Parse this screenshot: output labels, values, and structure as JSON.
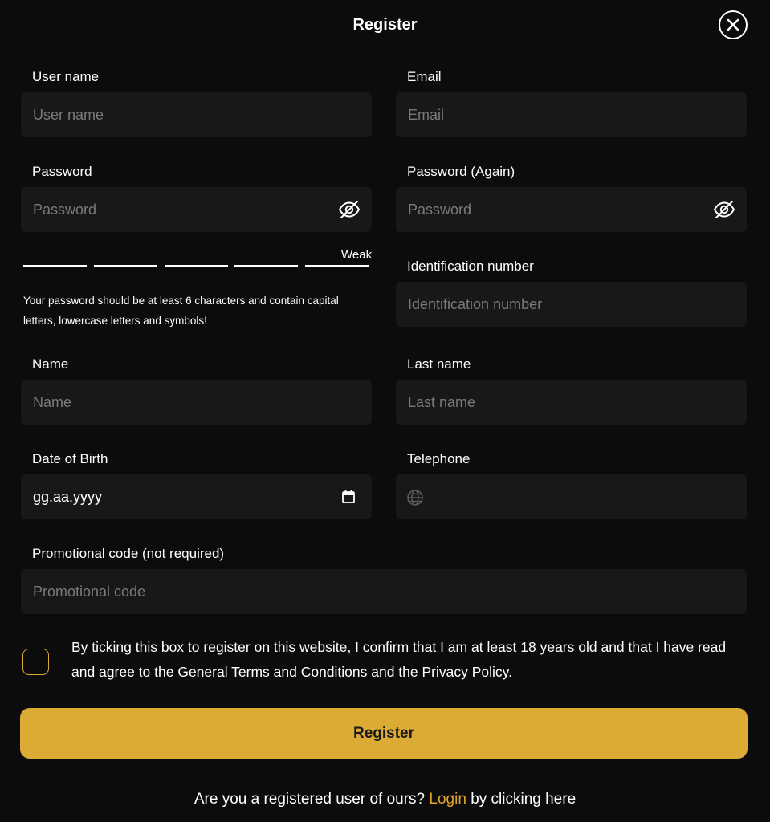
{
  "header": {
    "title": "Register"
  },
  "fields": {
    "username": {
      "label": "User name",
      "placeholder": "User name"
    },
    "email": {
      "label": "Email",
      "placeholder": "Email"
    },
    "password": {
      "label": "Password",
      "placeholder": "Password"
    },
    "password_again": {
      "label": "Password (Again)",
      "placeholder": "Password"
    },
    "identification": {
      "label": "Identification number",
      "placeholder": "Identification number"
    },
    "name": {
      "label": "Name",
      "placeholder": "Name"
    },
    "last_name": {
      "label": "Last name",
      "placeholder": "Last name"
    },
    "dob": {
      "label": "Date of Birth",
      "value": "gg.aa.yyyy"
    },
    "telephone": {
      "label": "Telephone",
      "value": ""
    },
    "promo": {
      "label": "Promotional code (not required)",
      "placeholder": "Promotional code"
    }
  },
  "password_strength": {
    "label": "Weak",
    "segments": 5,
    "hint": "Your password should be at least 6 characters and contain capital letters, lowercase letters and symbols!"
  },
  "terms": {
    "checked": false,
    "text": "By ticking this box to register on this website, I confirm that I am at least 18 years old and that I have read and agree to the General Terms and Conditions and the Privacy Policy."
  },
  "register_button": {
    "label": "Register"
  },
  "footer": {
    "prefix": "Are you a registered user of ours?",
    "link": "Login",
    "suffix": "by clicking here"
  },
  "icons": {
    "close": "close-icon",
    "eye": "eye-off-icon",
    "calendar": "calendar-icon",
    "globe": "globe-icon"
  },
  "colors": {
    "background": "#0c0c0c",
    "field": "#181818",
    "accent": "#dcab35",
    "link": "#e0a530"
  }
}
